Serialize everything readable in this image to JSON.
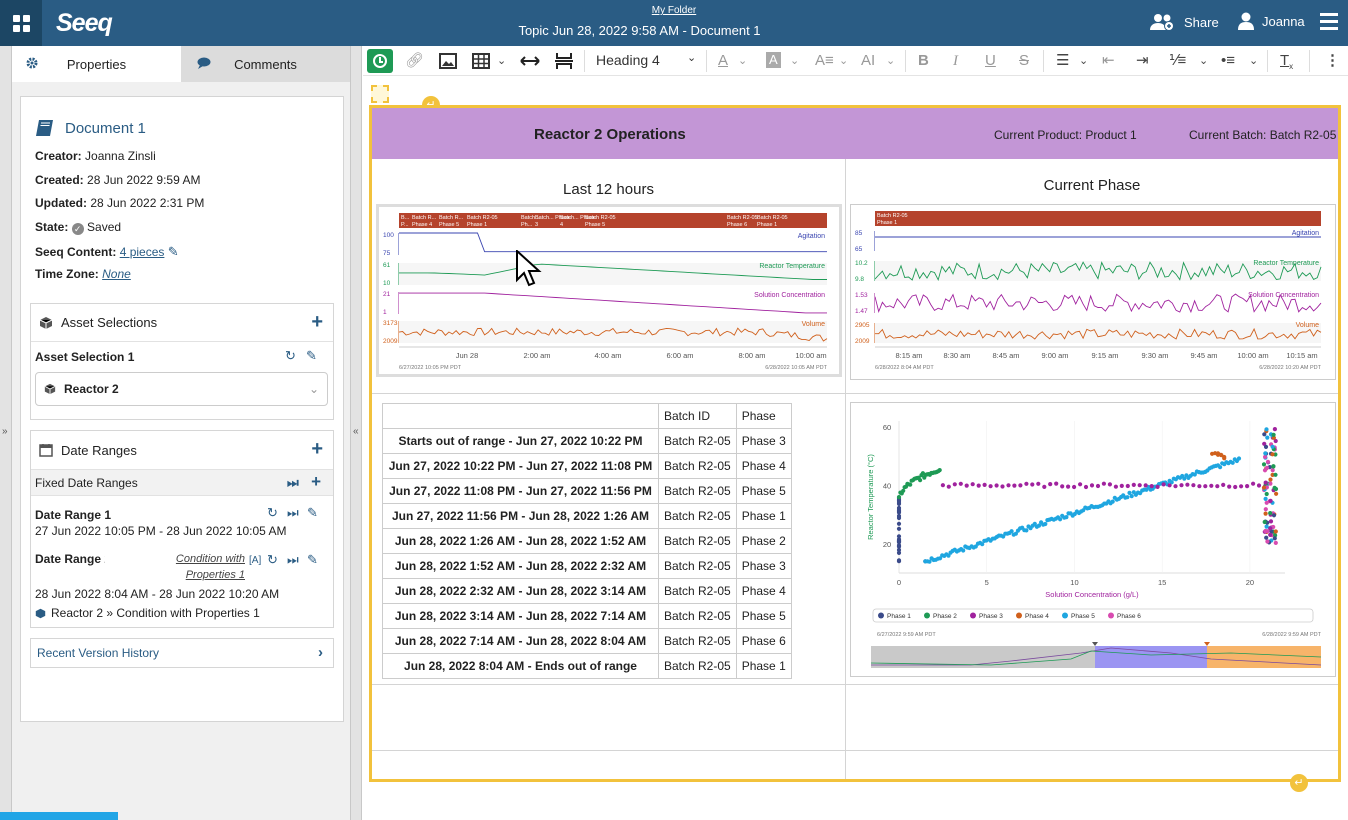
{
  "topbar": {
    "logo": "Seeq",
    "folder": "My Folder",
    "title": "Topic Jun 28, 2022 9:58 AM - Document 1",
    "share": "Share",
    "user": "Joanna"
  },
  "panel": {
    "tabs": [
      "Properties",
      "Comments"
    ],
    "doc_title": "Document 1",
    "creator_label": "Creator:",
    "creator": "Joanna Zinsli",
    "created_label": "Created:",
    "created": "28 Jun 2022 9:59 AM",
    "updated_label": "Updated:",
    "updated": "28 Jun 2022 2:31 PM",
    "state_label": "State:",
    "state": "Saved",
    "content_label": "Seeq Content:",
    "content": "4 pieces",
    "tz_label": "Time Zone:",
    "tz": "None",
    "asset_sel_header": "Asset Selections",
    "asset_sel_name": "Asset Selection 1",
    "asset_sel_value": "Reactor 2",
    "date_ranges_header": "Date Ranges",
    "fixed_ranges": "Fixed Date Ranges",
    "dr1_name": "Date Range 1",
    "dr1_value": "27 Jun 2022 10:05 PM - 28 Jun 2022 10:05 AM",
    "dr2_name": "Date Range 2",
    "dr2_condition": "Condition with Properties 1",
    "dr2_value": "28 Jun 2022 8:04 AM - 28 Jun 2022 10:20 AM",
    "dr2_path": "Reactor 2 » Condition with Properties 1",
    "version_history": "Recent Version History"
  },
  "toolbar": {
    "heading": "Heading 4"
  },
  "doc": {
    "banner_title": "Reactor 2 Operations",
    "product": "Current Product: Product 1",
    "batch": "Current Batch: Batch R2-05",
    "cell1_title": "Last 12 hours",
    "cell2_title": "Current Phase",
    "table_headers": [
      "",
      "Batch ID",
      "Phase"
    ],
    "table_rows": [
      [
        "Starts out of range - Jun 27, 2022 10:22 PM",
        "Batch R2-05",
        "Phase 3"
      ],
      [
        "Jun 27, 2022 10:22 PM - Jun 27, 2022 11:08 PM",
        "Batch R2-05",
        "Phase 4"
      ],
      [
        "Jun 27, 2022 11:08 PM - Jun 27, 2022 11:56 PM",
        "Batch R2-05",
        "Phase 5"
      ],
      [
        "Jun 27, 2022 11:56 PM - Jun 28, 2022 1:26 AM",
        "Batch R2-05",
        "Phase 1"
      ],
      [
        "Jun 28, 2022 1:26 AM - Jun 28, 2022 1:52 AM",
        "Batch R2-05",
        "Phase 2"
      ],
      [
        "Jun 28, 2022 1:52 AM - Jun 28, 2022 2:32 AM",
        "Batch R2-05",
        "Phase 3"
      ],
      [
        "Jun 28, 2022 2:32 AM - Jun 28, 2022 3:14 AM",
        "Batch R2-05",
        "Phase 4"
      ],
      [
        "Jun 28, 2022 3:14 AM - Jun 28, 2022 7:14 AM",
        "Batch R2-05",
        "Phase 5"
      ],
      [
        "Jun 28, 2022 7:14 AM - Jun 28, 2022 8:04 AM",
        "Batch R2-05",
        "Phase 6"
      ],
      [
        "Jun 28, 2022 8:04 AM - Ends out of range",
        "Batch R2-05",
        "Phase 1"
      ]
    ]
  },
  "colors": {
    "topbar": "#2a5c84",
    "banner": "#c396d6",
    "selection": "#f2c23c",
    "agitation": "#3a45b0",
    "temperature": "#1e9a55",
    "concentration": "#a0229e",
    "volume": "#d0601c",
    "capsule": "#b5432c"
  },
  "chart_data": [
    {
      "type": "line",
      "title": "",
      "x_ticks": [
        "Jun 28",
        "2:00 am",
        "4:00 am",
        "6:00 am",
        "8:00 am",
        "10:00 am"
      ],
      "start": "6/27/2022 10:05 PM PDT",
      "end": "6/28/2022 10:05 AM PDT",
      "capsules": [
        "B... P...",
        "Batch R... Phase 4",
        "Batch R... Phase 5",
        "Batch R2-05 Phase 1",
        "Batch... Ph...",
        "Batch... Phase 3",
        "Batch... Phase 4",
        "Batch R2-05 Phase 5",
        "Batch R2-05 Phase 6",
        "Batch R2-05 Phase 1"
      ],
      "series": [
        {
          "name": "Agitation",
          "y_range": [
            75,
            100
          ]
        },
        {
          "name": "Reactor Temperature",
          "y_range": [
            10,
            61
          ]
        },
        {
          "name": "Solution Concentration",
          "y_range": [
            1,
            21
          ]
        },
        {
          "name": "Volume",
          "y_range": [
            2009,
            3173
          ]
        }
      ]
    },
    {
      "type": "line",
      "title": "",
      "x_ticks": [
        "8:15 am",
        "8:30 am",
        "8:45 am",
        "9:00 am",
        "9:15 am",
        "9:30 am",
        "9:45 am",
        "10:00 am",
        "10:15 am"
      ],
      "start": "6/28/2022 8:04 AM PDT",
      "end": "6/28/2022 10:20 AM PDT",
      "capsules": [
        "Batch R2-05 Phase 1"
      ],
      "series": [
        {
          "name": "Agitation",
          "y_range": [
            65,
            85
          ]
        },
        {
          "name": "Reactor Temperature",
          "y_range": [
            9.8,
            10.2
          ]
        },
        {
          "name": "Solution Concentration",
          "y_range": [
            1.47,
            1.53
          ]
        },
        {
          "name": "Volume",
          "y_range": [
            2009,
            2905
          ]
        }
      ]
    },
    {
      "type": "scatter",
      "title": "",
      "xlabel": "Solution Concentration (g/L)",
      "ylabel": "Reactor Temperature (°C)",
      "x_ticks": [
        0,
        5,
        10,
        15,
        20
      ],
      "y_ticks": [
        20,
        40,
        60
      ],
      "xlim": [
        0,
        22
      ],
      "ylim": [
        10,
        62
      ],
      "legend": [
        "Phase 1",
        "Phase 2",
        "Phase 3",
        "Phase 4",
        "Phase 5",
        "Phase 6"
      ],
      "legend_colors": [
        "#3b4b8a",
        "#1e9a55",
        "#a0229e",
        "#d0601c",
        "#1fa6e0",
        "#d84bb0"
      ],
      "start": "6/27/2022 9:59 AM PDT",
      "end": "6/28/2022 9:59 AM PDT"
    }
  ]
}
